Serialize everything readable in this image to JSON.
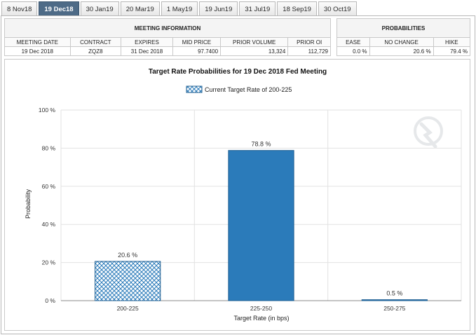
{
  "tabs": [
    {
      "label": "8 Nov18",
      "active": false
    },
    {
      "label": "19 Dec18",
      "active": true
    },
    {
      "label": "30 Jan19",
      "active": false
    },
    {
      "label": "20 Mar19",
      "active": false
    },
    {
      "label": "1 May19",
      "active": false
    },
    {
      "label": "19 Jun19",
      "active": false
    },
    {
      "label": "31 Jul19",
      "active": false
    },
    {
      "label": "18 Sep19",
      "active": false
    },
    {
      "label": "30 Oct19",
      "active": false
    }
  ],
  "meeting_info": {
    "heading": "MEETING INFORMATION",
    "columns": [
      "MEETING DATE",
      "CONTRACT",
      "EXPIRES",
      "MID PRICE",
      "PRIOR VOLUME",
      "PRIOR OI"
    ],
    "values": [
      "19 Dec 2018",
      "ZQZ8",
      "31 Dec 2018",
      "97.7400",
      "13,324",
      "112,729"
    ]
  },
  "probabilities": {
    "heading": "PROBABILITIES",
    "columns": [
      "EASE",
      "NO CHANGE",
      "HIKE"
    ],
    "values": [
      "0.0 %",
      "20.6 %",
      "79.4 %"
    ]
  },
  "chart_data": {
    "type": "bar",
    "title": "Target Rate Probabilities for 19 Dec 2018 Fed Meeting",
    "legend": {
      "label": "Current Target Rate of 200-225",
      "placement": "top-center"
    },
    "categories": [
      "200-225",
      "225-250",
      "250-275"
    ],
    "values": [
      20.6,
      78.8,
      0.5
    ],
    "value_labels": [
      "20.6 %",
      "78.8 %",
      "0.5 %"
    ],
    "highlight_category": "200-225",
    "xlabel": "Target Rate (in bps)",
    "ylabel": "Probability",
    "ylim": [
      0,
      100
    ],
    "yticks": [
      0,
      20,
      40,
      60,
      80,
      100
    ],
    "ytick_labels": [
      "0 %",
      "20 %",
      "40 %",
      "60 %",
      "80 %",
      "100 %"
    ],
    "grid": true,
    "colors": {
      "bar": "#2b7bba",
      "bar_stroke": "#1f5f92",
      "highlight_fill": "#ffffff",
      "highlight_pattern": "#2b7bba",
      "grid": "#e2e2e2",
      "axis": "#888888"
    }
  }
}
